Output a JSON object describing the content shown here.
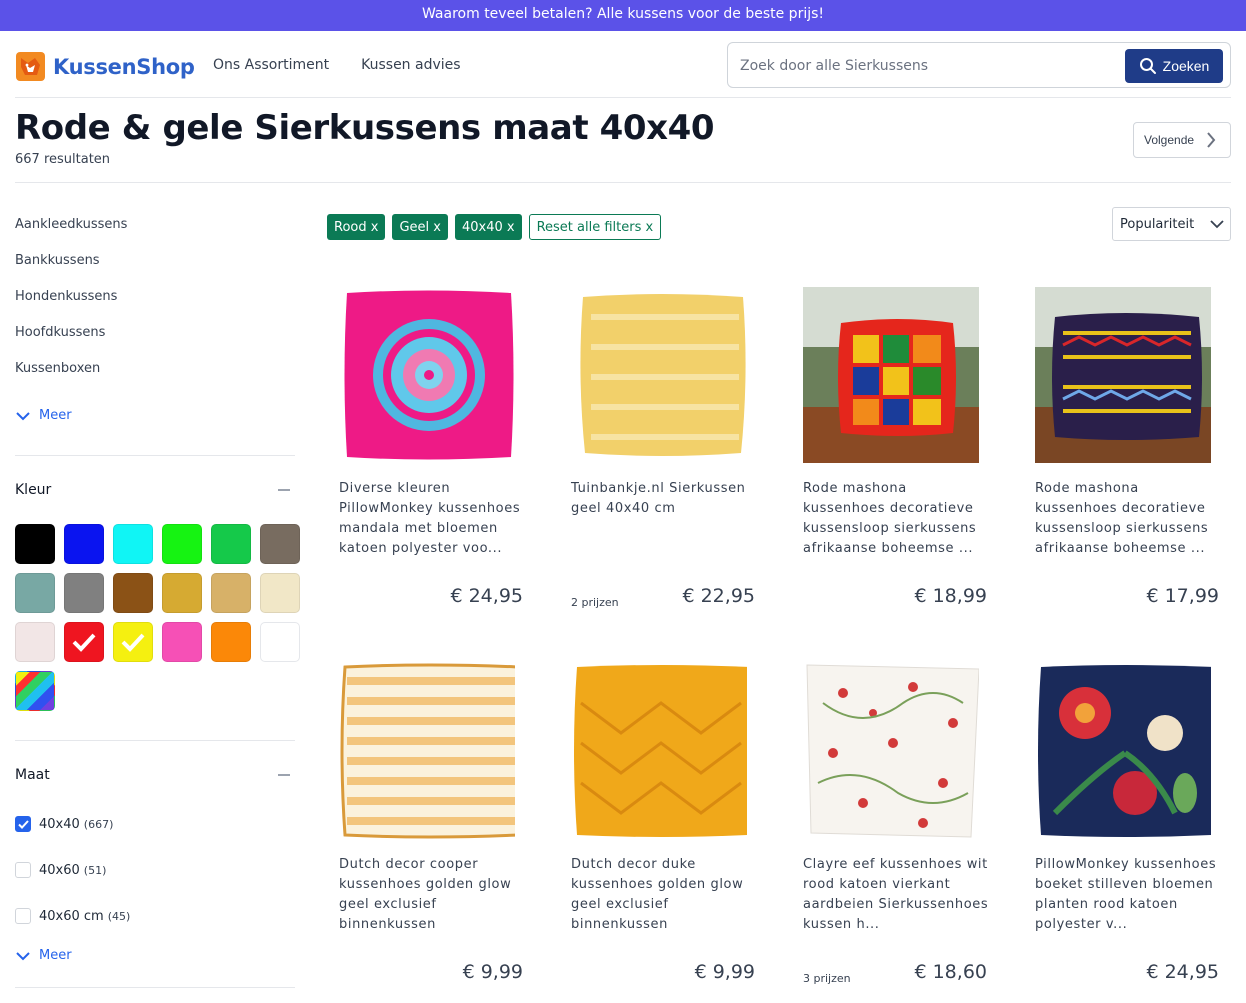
{
  "promo": {
    "text": "Waarom teveel betalen? Alle kussens voor de beste prijs!"
  },
  "header": {
    "logo_text": "KussenShop",
    "nav": [
      "Ons Assortiment",
      "Kussen advies"
    ],
    "search_placeholder": "Zoek door alle Sierkussens",
    "search_button": "Zoeken"
  },
  "page": {
    "title": "Rode & gele Sierkussens maat 40x40",
    "result_count": "667 resultaten",
    "next_label": "Volgende"
  },
  "sidebar": {
    "categories": [
      "Aankleedkussens",
      "Bankkussens",
      "Hondenkussens",
      "Hoofdkussens",
      "Kussenboxen"
    ],
    "more_label": "Meer",
    "color_title": "Kleur",
    "colors": [
      {
        "hex": "#000000",
        "checked": false
      },
      {
        "hex": "#0a14f0",
        "checked": false
      },
      {
        "hex": "#10f5f5",
        "checked": false
      },
      {
        "hex": "#16f312",
        "checked": false
      },
      {
        "hex": "#15c94a",
        "checked": false
      },
      {
        "hex": "#786c60",
        "checked": false
      },
      {
        "hex": "#78a8a4",
        "checked": false
      },
      {
        "hex": "#808080",
        "checked": false
      },
      {
        "hex": "#8b5216",
        "checked": false
      },
      {
        "hex": "#d6aa32",
        "checked": false
      },
      {
        "hex": "#d7b168",
        "checked": false
      },
      {
        "hex": "#f1e7c7",
        "checked": false
      },
      {
        "hex": "#f2e6e6",
        "checked": false
      },
      {
        "hex": "#ef1520",
        "checked": true
      },
      {
        "hex": "#f5f010",
        "checked": true
      },
      {
        "hex": "#f650b6",
        "checked": false
      },
      {
        "hex": "#fb8808",
        "checked": false
      },
      {
        "hex": "#ffffff",
        "checked": false
      },
      {
        "hex": "multicolor",
        "checked": false
      }
    ],
    "size_title": "Maat",
    "sizes": [
      {
        "label": "40x40",
        "count": "(667)",
        "checked": true
      },
      {
        "label": "40x60",
        "count": "(51)",
        "checked": false
      },
      {
        "label": "40x60 cm",
        "count": "(45)",
        "checked": false
      }
    ],
    "size_more_label": "Meer"
  },
  "filters": {
    "chips": [
      "Rood x",
      "Geel x",
      "40x40 x"
    ],
    "reset": "Reset alle filters x",
    "sort_value": "Populariteit"
  },
  "products": [
    {
      "name": "Diverse kleuren PillowMonkey kussenhoes mandala met bloemen katoen polyester voo...",
      "prijzen": "",
      "price": "€ 24,95"
    },
    {
      "name": "Tuinbankje.nl Sierkussen geel 40x40 cm",
      "prijzen": "2 prijzen",
      "price": "€ 22,95"
    },
    {
      "name": "Rode mashona kussenhoes decoratieve kussensloop sierkussens afrikaanse boheemse ...",
      "prijzen": "",
      "price": "€ 18,99"
    },
    {
      "name": "Rode mashona kussenhoes decoratieve kussensloop sierkussens afrikaanse boheemse ...",
      "prijzen": "",
      "price": "€ 17,99"
    },
    {
      "name": "Dutch decor cooper kussenhoes golden glow geel exclusief binnenkussen",
      "prijzen": "",
      "price": "€ 9,99"
    },
    {
      "name": "Dutch decor duke kussenhoes golden glow geel exclusief binnenkussen",
      "prijzen": "",
      "price": "€ 9,99"
    },
    {
      "name": "Clayre eef kussenhoes wit rood katoen vierkant aardbeien Sierkussenhoes kussen h...",
      "prijzen": "3 prijzen",
      "price": "€ 18,60"
    },
    {
      "name": "PillowMonkey kussenhoes boeket stilleven bloemen planten rood katoen polyester v...",
      "prijzen": "",
      "price": "€ 24,95"
    }
  ]
}
